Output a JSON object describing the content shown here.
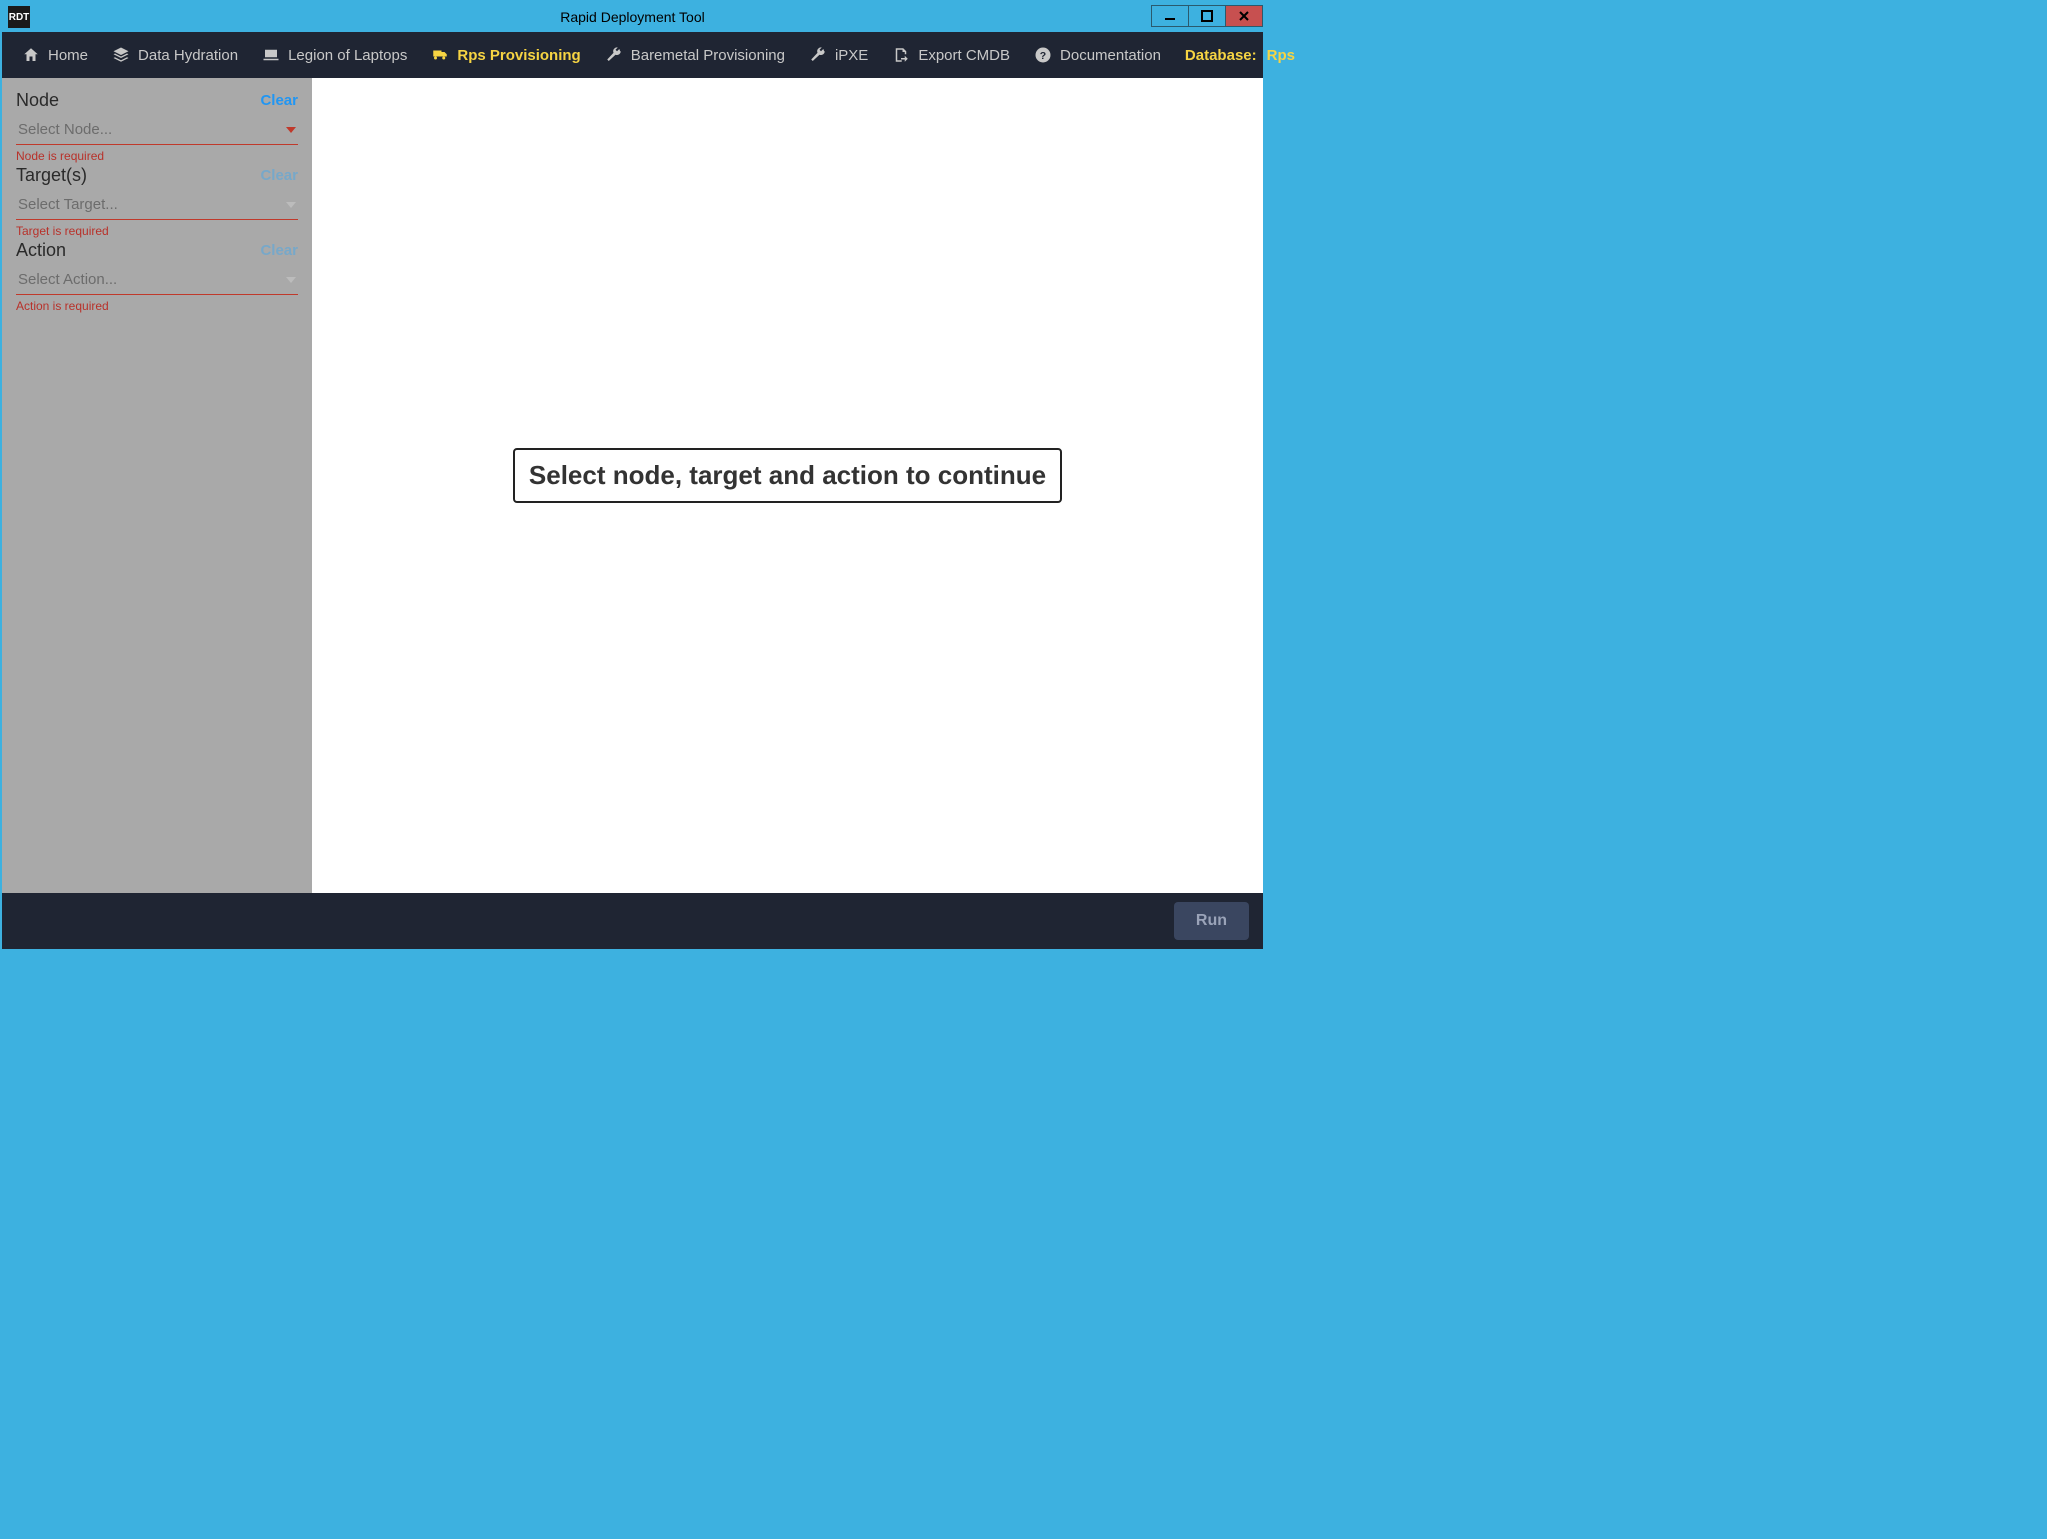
{
  "window": {
    "title": "Rapid Deployment Tool",
    "icon_text": "RDT"
  },
  "nav": {
    "items": [
      {
        "label": "Home",
        "icon": "home"
      },
      {
        "label": "Data Hydration",
        "icon": "layers"
      },
      {
        "label": "Legion of Laptops",
        "icon": "laptop"
      },
      {
        "label": "Rps Provisioning",
        "icon": "truck",
        "active": true
      },
      {
        "label": "Baremetal Provisioning",
        "icon": "wrench"
      },
      {
        "label": "iPXE",
        "icon": "wrench"
      },
      {
        "label": "Export CMDB",
        "icon": "export"
      },
      {
        "label": "Documentation",
        "icon": "help"
      }
    ],
    "database_label": "Database:",
    "database_value": "Rps"
  },
  "sidebar": {
    "node": {
      "label": "Node",
      "clear": "Clear",
      "placeholder": "Select Node...",
      "error": "Node is required",
      "clear_enabled": true
    },
    "target": {
      "label": "Target(s)",
      "clear": "Clear",
      "placeholder": "Select Target...",
      "error": "Target is required",
      "clear_enabled": false
    },
    "action": {
      "label": "Action",
      "clear": "Clear",
      "placeholder": "Select Action...",
      "error": "Action is required",
      "clear_enabled": false
    }
  },
  "main": {
    "prompt": "Select node, target and action to continue"
  },
  "footer": {
    "run": "Run"
  }
}
